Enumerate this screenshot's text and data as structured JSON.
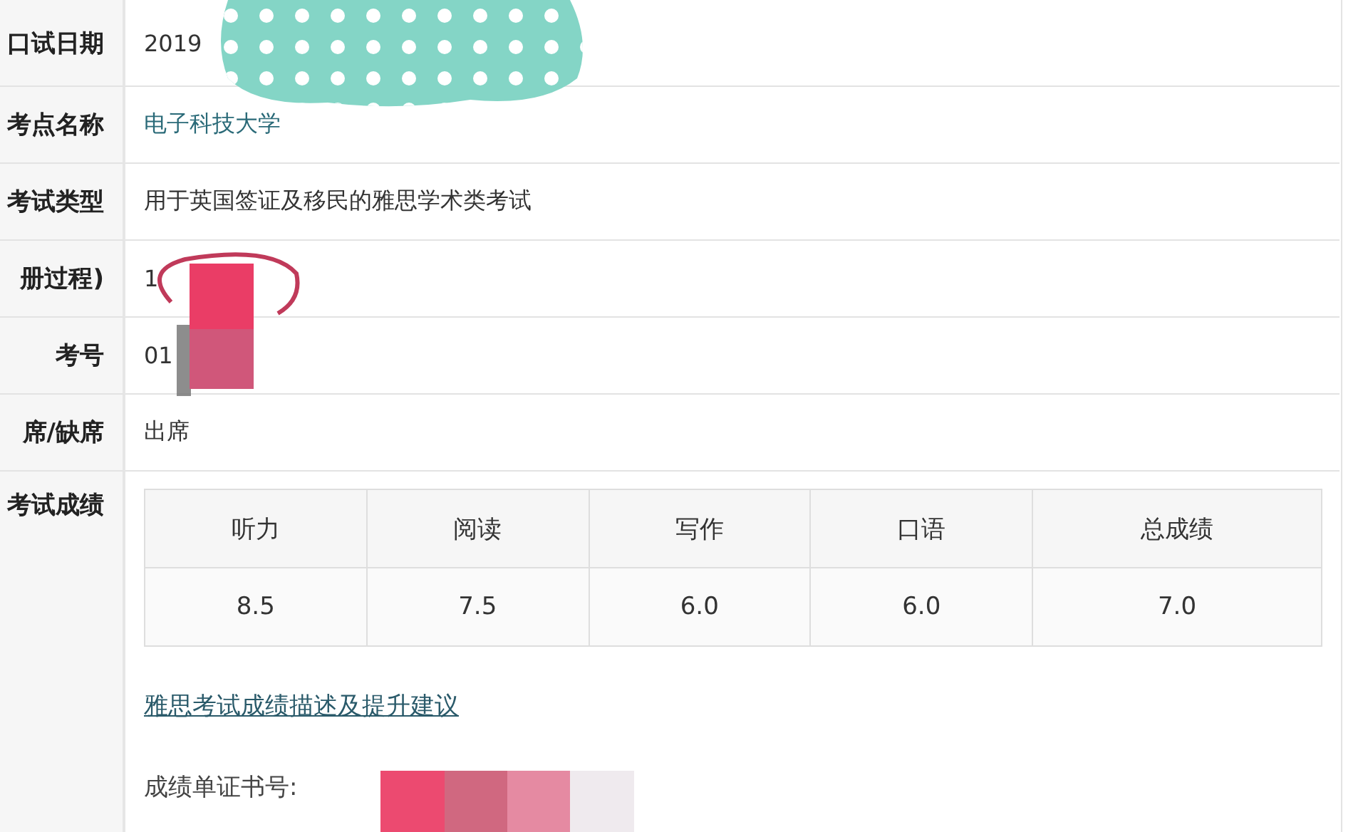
{
  "info_rows": [
    {
      "label": "口试日期",
      "value": "2019",
      "kind": "text"
    },
    {
      "label": "考点名称",
      "value": "电子科技大学",
      "kind": "link"
    },
    {
      "label": "考试类型",
      "value": "用于英国签证及移民的雅思学术类考试",
      "kind": "text"
    },
    {
      "label": "册过程)",
      "value": "1",
      "kind": "text"
    },
    {
      "label": "考号",
      "value": "01",
      "kind": "text"
    },
    {
      "label": "席/缺席",
      "value": "出席",
      "kind": "text"
    }
  ],
  "scores": {
    "label": "考试成绩",
    "columns": [
      "听力",
      "阅读",
      "写作",
      "口语",
      "总成绩"
    ],
    "values": [
      "8.5",
      "7.5",
      "6.0",
      "6.0",
      "7.0"
    ]
  },
  "advice_link": "雅思考试成绩描述及提升建议",
  "certificate_label": "成绩单证书号:"
}
